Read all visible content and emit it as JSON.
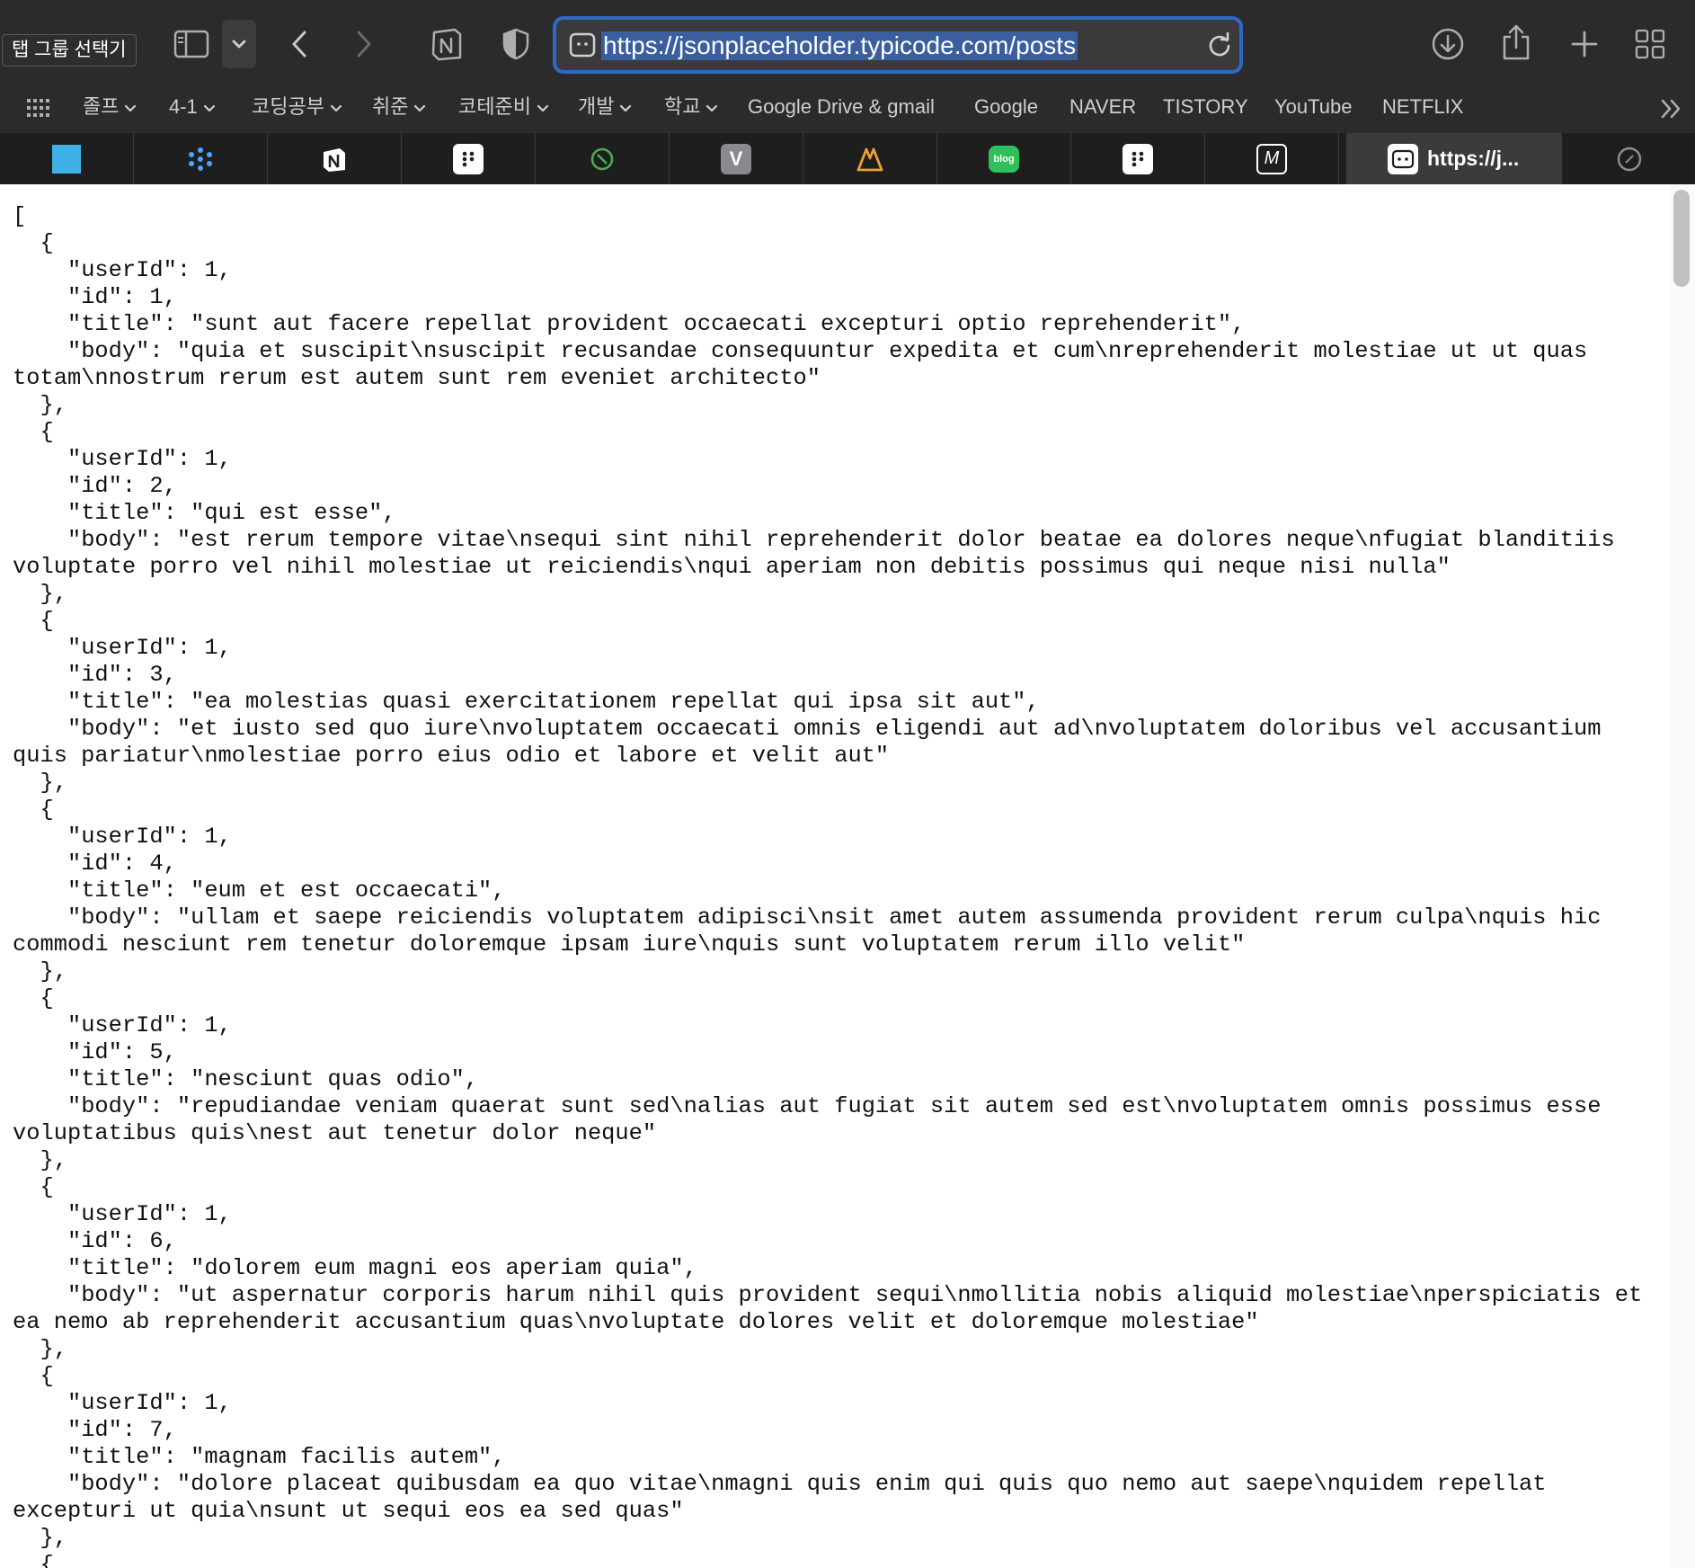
{
  "toolbar": {
    "tab_group_tooltip": "탭 그룹 선택기",
    "url": "https://jsonplaceholder.typicode.com/posts",
    "icons": [
      "sidebar-icon",
      "chevron-down-icon",
      "back-icon",
      "forward-icon",
      "notion-icon",
      "shield-icon",
      "page-icon",
      "reload-icon",
      "download-icon",
      "share-icon",
      "plus-icon",
      "tab-overview-icon"
    ]
  },
  "bookmarks": {
    "folders": [
      "졸프",
      "4-1",
      "코딩공부",
      "취준",
      "코테준비",
      "개발",
      "학교"
    ],
    "links": [
      "Google Drive & gmail",
      "Google",
      "NAVER",
      "TISTORY",
      "YouTube",
      "NETFLIX"
    ]
  },
  "tabs": {
    "favicons": [
      "blue-square",
      "asterisk",
      "notion",
      "dots",
      "leaf",
      "v",
      "triangle",
      "blog",
      "dots",
      "m"
    ],
    "blog_badge": "blog",
    "v_badge": "V",
    "m_badge": "M",
    "active_label": "https://j..."
  },
  "content": {
    "json_text": "[\n  {\n    \"userId\": 1,\n    \"id\": 1,\n    \"title\": \"sunt aut facere repellat provident occaecati excepturi optio reprehenderit\",\n    \"body\": \"quia et suscipit\\nsuscipit recusandae consequuntur expedita et cum\\nreprehenderit molestiae ut ut quas totam\\nnostrum rerum est autem sunt rem eveniet architecto\"\n  },\n  {\n    \"userId\": 1,\n    \"id\": 2,\n    \"title\": \"qui est esse\",\n    \"body\": \"est rerum tempore vitae\\nsequi sint nihil reprehenderit dolor beatae ea dolores neque\\nfugiat blanditiis voluptate porro vel nihil molestiae ut reiciendis\\nqui aperiam non debitis possimus qui neque nisi nulla\"\n  },\n  {\n    \"userId\": 1,\n    \"id\": 3,\n    \"title\": \"ea molestias quasi exercitationem repellat qui ipsa sit aut\",\n    \"body\": \"et iusto sed quo iure\\nvoluptatem occaecati omnis eligendi aut ad\\nvoluptatem doloribus vel accusantium quis pariatur\\nmolestiae porro eius odio et labore et velit aut\"\n  },\n  {\n    \"userId\": 1,\n    \"id\": 4,\n    \"title\": \"eum et est occaecati\",\n    \"body\": \"ullam et saepe reiciendis voluptatem adipisci\\nsit amet autem assumenda provident rerum culpa\\nquis hic commodi nesciunt rem tenetur doloremque ipsam iure\\nquis sunt voluptatem rerum illo velit\"\n  },\n  {\n    \"userId\": 1,\n    \"id\": 5,\n    \"title\": \"nesciunt quas odio\",\n    \"body\": \"repudiandae veniam quaerat sunt sed\\nalias aut fugiat sit autem sed est\\nvoluptatem omnis possimus esse voluptatibus quis\\nest aut tenetur dolor neque\"\n  },\n  {\n    \"userId\": 1,\n    \"id\": 6,\n    \"title\": \"dolorem eum magni eos aperiam quia\",\n    \"body\": \"ut aspernatur corporis harum nihil quis provident sequi\\nmollitia nobis aliquid molestiae\\nperspiciatis et ea nemo ab reprehenderit accusantium quas\\nvoluptate dolores velit et doloremque molestiae\"\n  },\n  {\n    \"userId\": 1,\n    \"id\": 7,\n    \"title\": \"magnam facilis autem\",\n    \"body\": \"dolore placeat quibusdam ea quo vitae\\nmagni quis enim qui quis quo nemo aut saepe\\nquidem repellat excepturi ut quia\\nsunt ut sequi eos ea sed quas\"\n  },\n  {"
  }
}
